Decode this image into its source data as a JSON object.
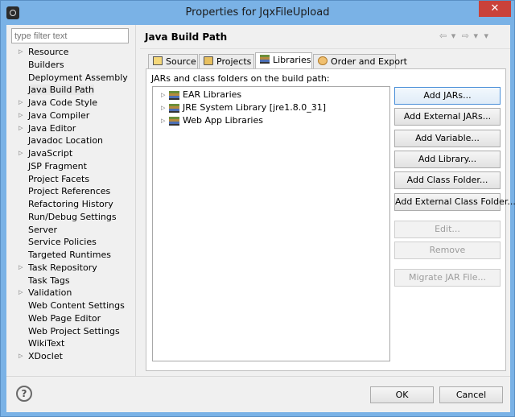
{
  "window": {
    "title": "Properties for JqxFileUpload",
    "close_glyph": "✕"
  },
  "filter": {
    "placeholder": "type filter text"
  },
  "nav": {
    "items": [
      {
        "label": "Resource",
        "expandable": true
      },
      {
        "label": "Builders",
        "expandable": false
      },
      {
        "label": "Deployment Assembly",
        "expandable": false
      },
      {
        "label": "Java Build Path",
        "expandable": false,
        "selected": true
      },
      {
        "label": "Java Code Style",
        "expandable": true
      },
      {
        "label": "Java Compiler",
        "expandable": true
      },
      {
        "label": "Java Editor",
        "expandable": true
      },
      {
        "label": "Javadoc Location",
        "expandable": false
      },
      {
        "label": "JavaScript",
        "expandable": true
      },
      {
        "label": "JSP Fragment",
        "expandable": false
      },
      {
        "label": "Project Facets",
        "expandable": false
      },
      {
        "label": "Project References",
        "expandable": false
      },
      {
        "label": "Refactoring History",
        "expandable": false
      },
      {
        "label": "Run/Debug Settings",
        "expandable": false
      },
      {
        "label": "Server",
        "expandable": false
      },
      {
        "label": "Service Policies",
        "expandable": false
      },
      {
        "label": "Targeted Runtimes",
        "expandable": false
      },
      {
        "label": "Task Repository",
        "expandable": true
      },
      {
        "label": "Task Tags",
        "expandable": false
      },
      {
        "label": "Validation",
        "expandable": true
      },
      {
        "label": "Web Content Settings",
        "expandable": false
      },
      {
        "label": "Web Page Editor",
        "expandable": false
      },
      {
        "label": "Web Project Settings",
        "expandable": false
      },
      {
        "label": "WikiText",
        "expandable": false
      },
      {
        "label": "XDoclet",
        "expandable": true
      }
    ]
  },
  "page": {
    "title": "Java Build Path",
    "history": {
      "back": "⇦ ▾",
      "forward": "⇨ ▾",
      "menu": "▾"
    }
  },
  "tabs": [
    {
      "label": "Source",
      "icon": "source-folder-icon"
    },
    {
      "label": "Projects",
      "icon": "projects-icon"
    },
    {
      "label": "Libraries",
      "icon": "libraries-icon",
      "active": true
    },
    {
      "label": "Order and Export",
      "icon": "order-export-icon"
    }
  ],
  "libraries": {
    "heading": "JARs and class folders on the build path:",
    "entries": [
      {
        "label": "EAR Libraries"
      },
      {
        "label": "JRE System Library [jre1.8.0_31]"
      },
      {
        "label": "Web App Libraries"
      }
    ],
    "buttons": {
      "add_jars": "Add JARs...",
      "add_external_jars": "Add External JARs...",
      "add_variable": "Add Variable...",
      "add_library": "Add Library...",
      "add_class_folder": "Add Class Folder...",
      "add_external_class_folder": "Add External Class Folder...",
      "edit": "Edit...",
      "remove": "Remove",
      "migrate_jar": "Migrate JAR File..."
    }
  },
  "footer": {
    "help": "?",
    "ok": "OK",
    "cancel": "Cancel"
  },
  "twisty_glyph": "▷"
}
